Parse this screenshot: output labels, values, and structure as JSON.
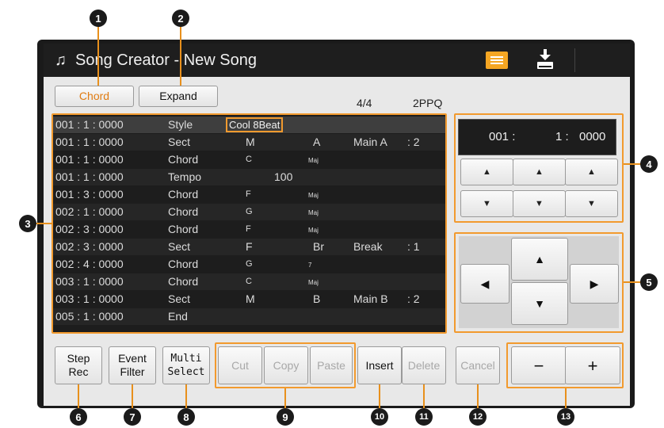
{
  "window": {
    "title": "Song Creator - New Song"
  },
  "top_buttons": {
    "chord": "Chord",
    "expand": "Expand"
  },
  "info": {
    "time_signature": "4/4",
    "resolution": "2PPQ"
  },
  "events": [
    {
      "pos": "001 : 1 : 0000",
      "type": "Style",
      "v1": "Cool 8Beat",
      "v2": "",
      "v3": "",
      "v4": "",
      "selected": true
    },
    {
      "pos": "001 : 1 : 0000",
      "type": "Sect",
      "v1": "M",
      "v2": "A",
      "v3": "Main A",
      "v4": ": 2"
    },
    {
      "pos": "001 : 1 : 0000",
      "type": "Chord",
      "v1": "C",
      "v2": "Maj",
      "v3": "",
      "v4": ""
    },
    {
      "pos": "001 : 1 : 0000",
      "type": "Tempo",
      "v1": "100",
      "v2": "",
      "v3": "",
      "v4": ""
    },
    {
      "pos": "001 : 3 : 0000",
      "type": "Chord",
      "v1": "F",
      "v2": "Maj",
      "v3": "",
      "v4": ""
    },
    {
      "pos": "002 : 1 : 0000",
      "type": "Chord",
      "v1": "G",
      "v2": "Maj",
      "v3": "",
      "v4": ""
    },
    {
      "pos": "002 : 3 : 0000",
      "type": "Chord",
      "v1": "F",
      "v2": "Maj",
      "v3": "",
      "v4": ""
    },
    {
      "pos": "002 : 3 : 0000",
      "type": "Sect",
      "v1": "F",
      "v2": "Br",
      "v3": "Break",
      "v4": ": 1"
    },
    {
      "pos": "002 : 4 : 0000",
      "type": "Chord",
      "v1": "G",
      "v2": "7",
      "v3": "",
      "v4": ""
    },
    {
      "pos": "003 : 1 : 0000",
      "type": "Chord",
      "v1": "C",
      "v2": "Maj",
      "v3": "",
      "v4": ""
    },
    {
      "pos": "003 : 1 : 0000",
      "type": "Sect",
      "v1": "M",
      "v2": "B",
      "v3": "Main B",
      "v4": ": 2"
    },
    {
      "pos": "005 : 1 : 0000",
      "type": "End",
      "v1": "",
      "v2": "",
      "v3": "",
      "v4": ""
    }
  ],
  "position_display": {
    "measure": "001 :",
    "beat": "1 :",
    "clock": "0000"
  },
  "bottom_buttons": {
    "step_rec": [
      "Step",
      "Rec"
    ],
    "event_filter": [
      "Event",
      "Filter"
    ],
    "multi_select": [
      "Multi",
      "Select"
    ],
    "cut": "Cut",
    "copy": "Copy",
    "paste": "Paste",
    "insert": "Insert",
    "delete": "Delete",
    "cancel": "Cancel",
    "minus": "−",
    "plus": "+"
  },
  "callouts": [
    "1",
    "2",
    "3",
    "4",
    "5",
    "6",
    "7",
    "8",
    "9",
    "10",
    "11",
    "12",
    "13"
  ],
  "colors": {
    "accent": "#f29a2e",
    "list_bg": "#1d1d1d",
    "panel_bg": "#e8e8e8",
    "title_bg": "#1e1e1e",
    "callout_bg": "#1b1b1b"
  },
  "icons": [
    "music-note-icon",
    "list-view-icon",
    "save-download-icon",
    "arrow-up-icon",
    "arrow-down-icon",
    "arrow-left-icon",
    "arrow-right-icon"
  ]
}
